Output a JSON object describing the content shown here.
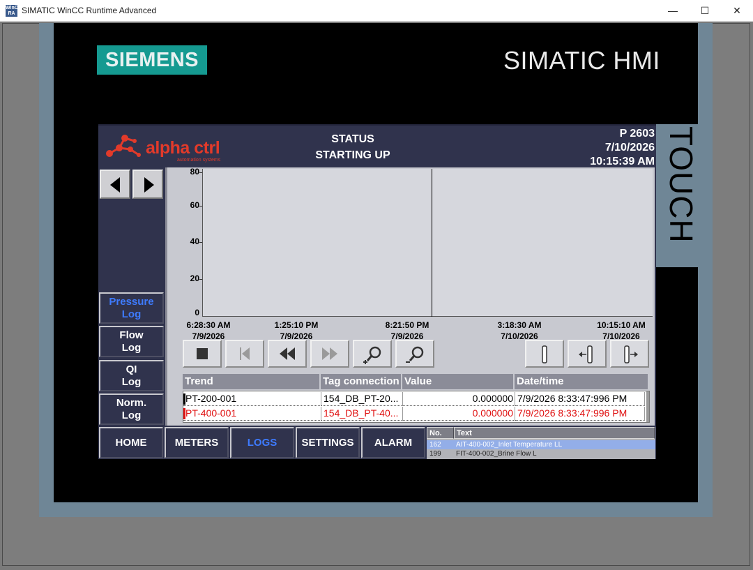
{
  "window": {
    "icon_label": "WinCC RA",
    "title": "SIMATIC WinCC Runtime Advanced",
    "minimize_glyph": "—",
    "maximize_glyph": "☐",
    "close_glyph": "✕"
  },
  "device": {
    "brand": "SIEMENS",
    "product": "SIMATIC HMI",
    "side_label": "TOUCH"
  },
  "header": {
    "company": "alpha ctrl",
    "company_tagline": "automation systems",
    "status_label": "STATUS",
    "status_value": "STARTING UP",
    "station": "P 2603",
    "date": "7/10/2026",
    "time": "10:15:39 AM"
  },
  "left_nav": {
    "logs": [
      {
        "line1": "Pressure",
        "line2": "Log",
        "active": true
      },
      {
        "line1": "Flow",
        "line2": "Log",
        "active": false
      },
      {
        "line1": "QI",
        "line2": "Log",
        "active": false
      },
      {
        "line1": "Norm.",
        "line2": "Log",
        "active": false
      }
    ]
  },
  "trend": {
    "y_ticks": [
      "80",
      "60",
      "40",
      "20",
      "0"
    ],
    "x_labels": [
      {
        "time": "6:28:30 AM",
        "date": "7/9/2026"
      },
      {
        "time": "1:25:10 PM",
        "date": "7/9/2026"
      },
      {
        "time": "8:21:50 PM",
        "date": "7/9/2026"
      },
      {
        "time": "3:18:30 AM",
        "date": "7/10/2026"
      },
      {
        "time": "10:15:10 AM",
        "date": "7/10/2026"
      }
    ],
    "columns": [
      "Trend",
      "Tag connection",
      "Value",
      "Date/time"
    ],
    "rows": [
      {
        "trend": "PT-200-001",
        "tag": "154_DB_PT-20...",
        "value": "0.000000",
        "datetime": "7/9/2026 8:33:47:996 PM",
        "color": "#000000"
      },
      {
        "trend": "PT-400-001",
        "tag": "154_DB_PT-40...",
        "value": "0.000000",
        "datetime": "7/9/2026 8:33:47:996 PM",
        "color": "#e01010"
      }
    ]
  },
  "bottom_nav": [
    {
      "label": "HOME",
      "active": false
    },
    {
      "label": "METERS",
      "active": false
    },
    {
      "label": "LOGS",
      "active": true
    },
    {
      "label": "SETTINGS",
      "active": false
    },
    {
      "label": "ALARM",
      "active": false
    }
  ],
  "alarms": {
    "columns": [
      "No.",
      "Text"
    ],
    "rows": [
      {
        "no": "162",
        "text": "AIT-400-002_Inlet Temperature LL",
        "selected": true
      },
      {
        "no": "199",
        "text": "FIT-400-002_Brine Flow L",
        "selected": false
      }
    ]
  },
  "colors": {
    "screen_bg": "#30334d",
    "accent_active": "#3e7bff",
    "alarm_red": "#e01010",
    "brand_teal": "#159a91"
  }
}
